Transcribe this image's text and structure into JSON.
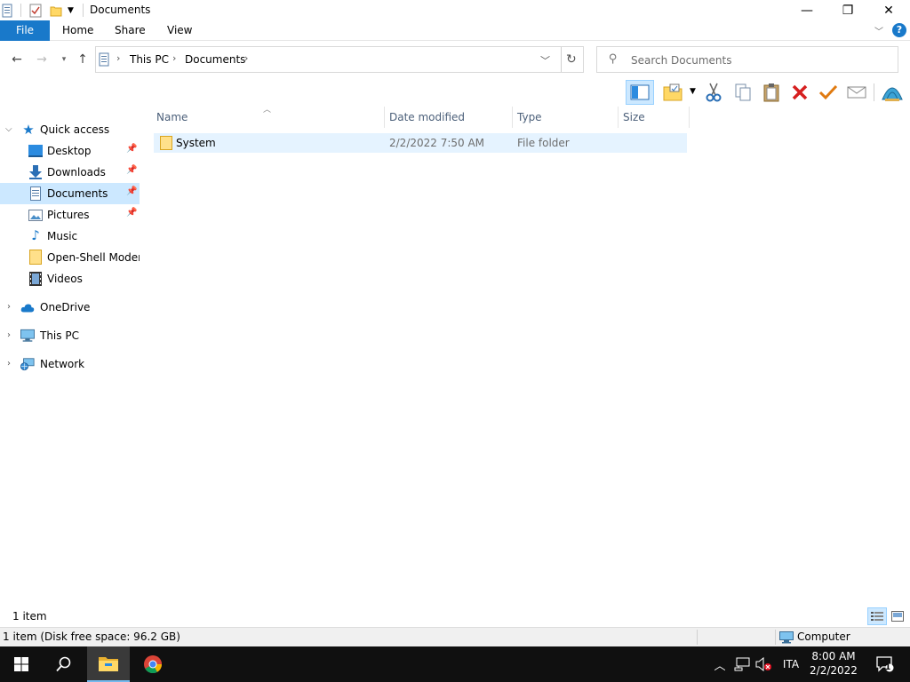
{
  "window": {
    "title": "Documents",
    "minimize_glyph": "—",
    "restore_glyph": "❐",
    "close_glyph": "✕"
  },
  "ribbon": {
    "tabs": [
      "File",
      "Home",
      "Share",
      "View"
    ],
    "help_glyph": "?"
  },
  "address": {
    "crumbs": [
      "This PC",
      "Documents"
    ],
    "search_placeholder": "Search Documents"
  },
  "nav": {
    "quick_access": "Quick access",
    "items": [
      {
        "label": "Desktop",
        "icon": "desktop-icon",
        "pinned": true
      },
      {
        "label": "Downloads",
        "icon": "downloads-icon",
        "pinned": true
      },
      {
        "label": "Documents",
        "icon": "documents-icon",
        "pinned": true,
        "selected": true
      },
      {
        "label": "Pictures",
        "icon": "pictures-icon",
        "pinned": true
      },
      {
        "label": "Music",
        "icon": "music-icon",
        "pinned": false
      },
      {
        "label": "Open-Shell Modern",
        "icon": "folder-icon",
        "pinned": false
      },
      {
        "label": "Videos",
        "icon": "videos-icon",
        "pinned": false
      }
    ],
    "roots": [
      "OneDrive",
      "This PC",
      "Network"
    ]
  },
  "columns": [
    "Name",
    "Date modified",
    "Type",
    "Size"
  ],
  "files": [
    {
      "name": "System",
      "modified": "2/2/2022 7:50 AM",
      "type": "File folder",
      "size": ""
    }
  ],
  "status": {
    "count": "1 item",
    "details": "1 item (Disk free space: 96.2 GB)",
    "location": "Computer"
  },
  "taskbar": {
    "language": "ITA",
    "time": "8:00 AM",
    "date": "2/2/2022",
    "notification_count": "1"
  },
  "colors": {
    "accent": "#1979ca",
    "selection": "#cce8ff",
    "taskbar": "#101010"
  }
}
